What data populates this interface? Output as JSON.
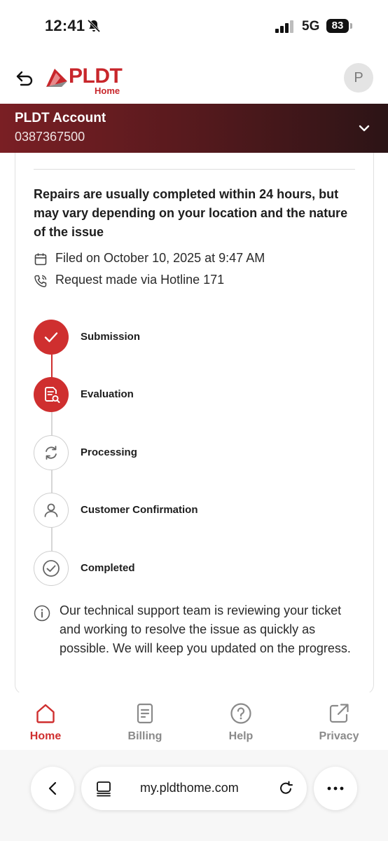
{
  "status_bar": {
    "time": "12:41",
    "network": "5G",
    "battery": "83"
  },
  "header": {
    "brand": "PLDT",
    "brand_sub": "Home",
    "avatar_initial": "P"
  },
  "account": {
    "title": "PLDT Account",
    "number": "0387367500"
  },
  "ticket": {
    "headline": "Repairs are usually completed within 24 hours, but may vary depending on your location and the nature of the issue",
    "filed": "Filed on October 10, 2025 at 9:47 AM",
    "channel": "Request made via Hotline 171",
    "steps": [
      {
        "label": "Submission",
        "state": "done"
      },
      {
        "label": "Evaluation",
        "state": "current"
      },
      {
        "label": "Processing",
        "state": "pending"
      },
      {
        "label": "Customer Confirmation",
        "state": "pending"
      },
      {
        "label": "Completed",
        "state": "pending"
      }
    ],
    "info": "Our technical support team is reviewing your ticket and working to resolve the issue as quickly as possible. We will keep you updated on the progress."
  },
  "bottom_nav": [
    {
      "label": "Home",
      "icon": "home-icon",
      "active": true
    },
    {
      "label": "Billing",
      "icon": "billing-icon",
      "active": false
    },
    {
      "label": "Help",
      "icon": "help-icon",
      "active": false
    },
    {
      "label": "Privacy",
      "icon": "external-link-icon",
      "active": false
    }
  ],
  "browser": {
    "url": "my.pldthome.com"
  },
  "colors": {
    "brand_red": "#cf2f2f",
    "account_bar_dark": "#2c1416",
    "inactive_gray": "#8a8a8a"
  }
}
